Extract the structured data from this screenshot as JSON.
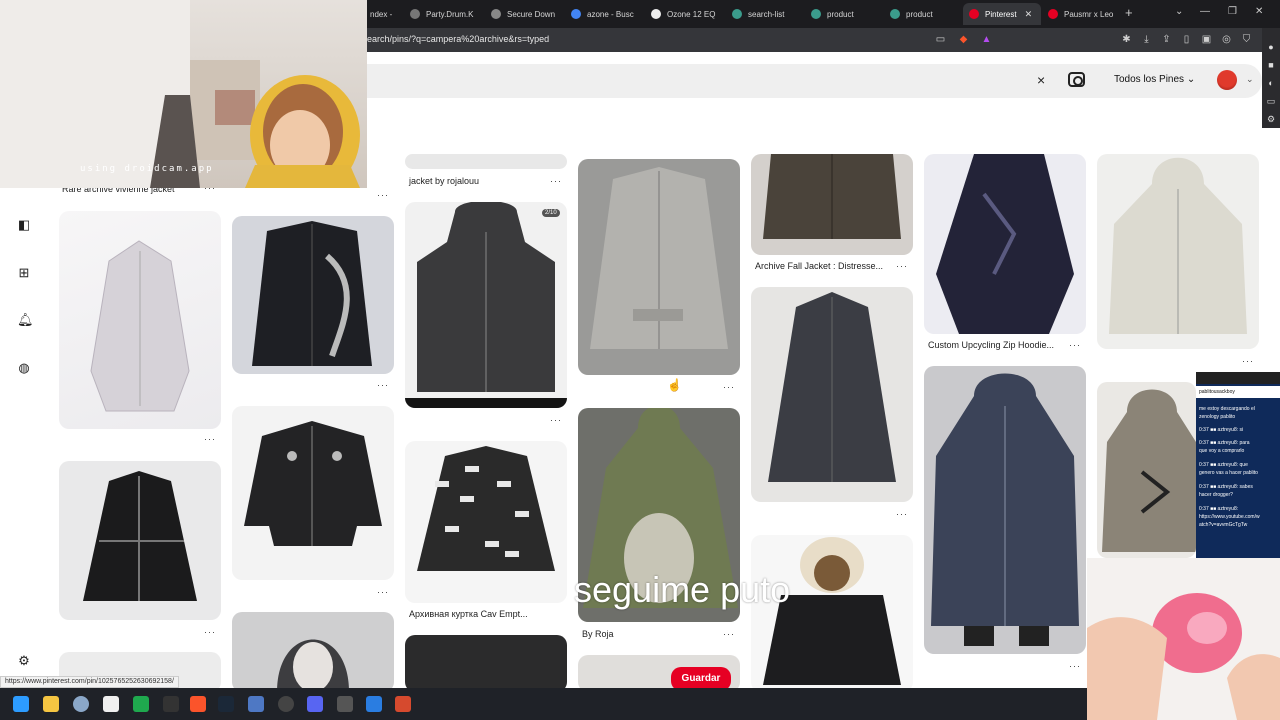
{
  "browser": {
    "tabs": [
      {
        "label": "ndex -",
        "color": "#888"
      },
      {
        "label": "Party.Drum.K",
        "color": "#888"
      },
      {
        "label": "Secure Down",
        "color": "#888"
      },
      {
        "label": "azone - Busc",
        "color": "#4285f4"
      },
      {
        "label": "Ozone 12 EQ",
        "color": "#ddd"
      },
      {
        "label": "search-list",
        "color": "#3b9c8c"
      },
      {
        "label": "product",
        "color": "#3b9c8c"
      },
      {
        "label": "product",
        "color": "#3b9c8c"
      },
      {
        "label": "Pinterest",
        "color": "#e60023",
        "active": true
      },
      {
        "label": "Pausmr x Leo",
        "color": "#e60023"
      }
    ],
    "new_tab": "+",
    "url": "earch/pins/?q=campera%20archive&rs=typed",
    "status_url": "https://www.pinterest.com/pin/1025765252630692158/"
  },
  "header": {
    "clear_icon": "×",
    "filter_label": "Todos los Pines",
    "filter_caret": "⌄"
  },
  "pins": [
    {
      "title": "Rare archive vivienne jacket",
      "dots": "···"
    },
    {
      "title": "jacket by rojalouu",
      "dots": "···"
    },
    {
      "title": "Archive Fall Jacket : Distresse...",
      "dots": "···"
    },
    {
      "title": "Custom Upcycling Zip Hoodie...",
      "dots": "···"
    },
    {
      "title": "Архивная куртка Cav Empt...",
      "dots": "···"
    },
    {
      "title": "By Roja",
      "dots": "···"
    },
    {
      "badge": "2/10"
    }
  ],
  "dots": "···",
  "save_button": "Guardar",
  "overlay": {
    "webcam_text": "using droidcam.app",
    "stream_text": "seguime puto"
  },
  "chat": {
    "lines": [
      "pablitousackboy",
      "me estoy descargando el",
      "zenology pablito",
      "0:37 ■■ aztreyu8: si",
      "0:37 ■■ aztreyu8: para",
      "que voy a comprarlo",
      "0:37 ■■ aztreyu8: que",
      "genero vas a hacer pablito",
      "0:37 ■■ aztreyu8: sabes",
      "hacer drogger?",
      "0:37 ■■ aztreyu8:",
      "https://www.youtube.com/w",
      "atch?v=avvmGcTgTw"
    ]
  },
  "colors": {
    "accent": "#e60023",
    "chrome_dark": "#1c1c1f"
  }
}
